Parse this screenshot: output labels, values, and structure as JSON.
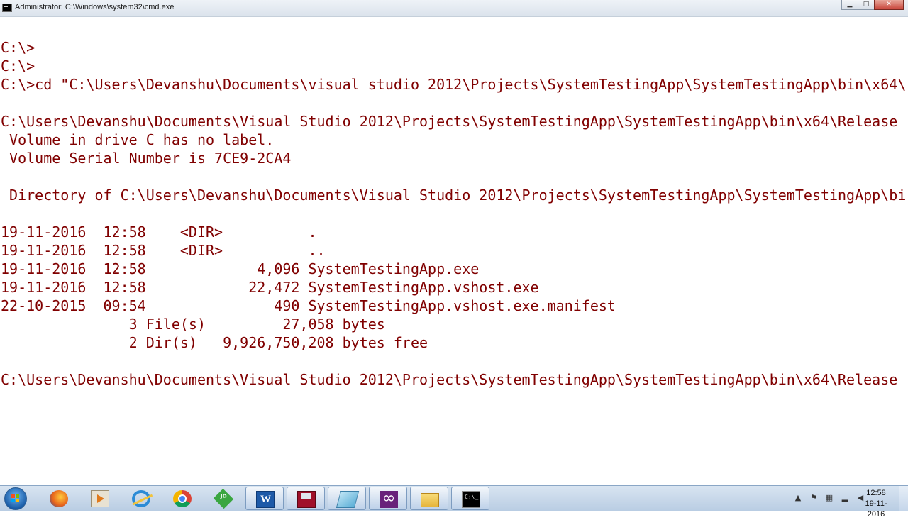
{
  "window": {
    "title": "Administrator: C:\\Windows\\system32\\cmd.exe",
    "controls": {
      "minimize": "▁",
      "maximize": "□",
      "close": "✕"
    }
  },
  "console": {
    "text_color": "#800000",
    "background": "#ffffff",
    "lines": [
      "C:\\>",
      "C:\\>",
      "C:\\>cd \"C:\\Users\\Devanshu\\Documents\\visual studio 2012\\Projects\\SystemTestingApp\\SystemTestingApp\\bin\\x64\\",
      "",
      "C:\\Users\\Devanshu\\Documents\\Visual Studio 2012\\Projects\\SystemTestingApp\\SystemTestingApp\\bin\\x64\\Release",
      " Volume in drive C has no label.",
      " Volume Serial Number is 7CE9-2CA4",
      "",
      " Directory of C:\\Users\\Devanshu\\Documents\\Visual Studio 2012\\Projects\\SystemTestingApp\\SystemTestingApp\\bi",
      "",
      "19-11-2016  12:58    <DIR>          .",
      "19-11-2016  12:58    <DIR>          ..",
      "19-11-2016  12:58             4,096 SystemTestingApp.exe",
      "19-11-2016  12:58            22,472 SystemTestingApp.vshost.exe",
      "22-10-2015  09:54               490 SystemTestingApp.vshost.exe.manifest",
      "               3 File(s)         27,058 bytes",
      "               2 Dir(s)   9,926,750,208 bytes free",
      "",
      "C:\\Users\\Devanshu\\Documents\\Visual Studio 2012\\Projects\\SystemTestingApp\\SystemTestingApp\\bin\\x64\\Release"
    ]
  },
  "taskbar": {
    "start": "start-button",
    "apps": [
      {
        "name": "firefox",
        "icon": "firefox-icon",
        "active": false
      },
      {
        "name": "media-player",
        "icon": "media-player-icon",
        "active": false
      },
      {
        "name": "internet-explorer",
        "icon": "internet-explorer-icon",
        "active": false
      },
      {
        "name": "chrome",
        "icon": "chrome-icon",
        "active": false
      },
      {
        "name": "jdownloader",
        "icon": "jdownloader-icon",
        "active": false
      },
      {
        "name": "word",
        "icon": "word-icon",
        "active": true
      },
      {
        "name": "save-tool",
        "icon": "save-icon",
        "active": true
      },
      {
        "name": "notepad",
        "icon": "notepad-icon",
        "active": true
      },
      {
        "name": "visual-studio",
        "icon": "visual-studio-icon",
        "active": true
      },
      {
        "name": "explorer",
        "icon": "folder-icon",
        "active": true
      },
      {
        "name": "cmd",
        "icon": "cmd-icon",
        "active": true
      }
    ],
    "tray": {
      "show_hidden": "▲",
      "icons": [
        "flag-icon",
        "network-icon",
        "signal-icon",
        "volume-icon"
      ]
    },
    "clock": {
      "time": "12:58",
      "date": "19-11-2016"
    }
  }
}
